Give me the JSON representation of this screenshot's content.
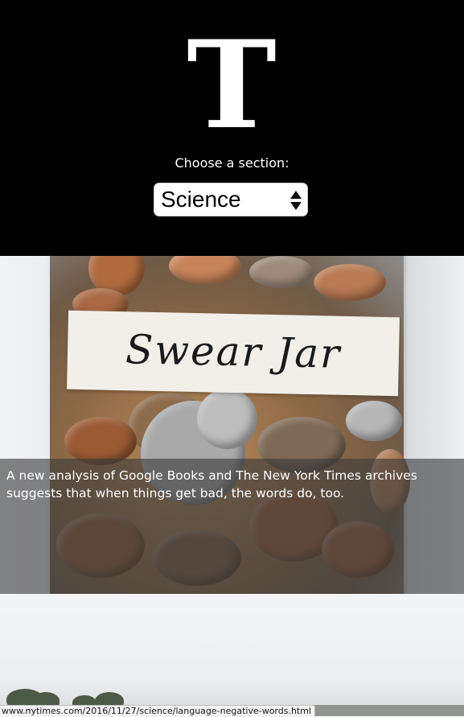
{
  "header": {
    "logo_glyph": "T",
    "prompt": "Choose a section:",
    "section_select": {
      "selected": "Science"
    }
  },
  "articles": [
    {
      "image_label_text": "Swear Jar",
      "caption": "A new analysis of Google Books and The New York Times archives suggests that when things get bad, the words do, too."
    },
    {
      "caption": ""
    }
  ],
  "status_bar": {
    "url": "www.nytimes.com/2016/11/27/science/language-negative-words.html"
  }
}
